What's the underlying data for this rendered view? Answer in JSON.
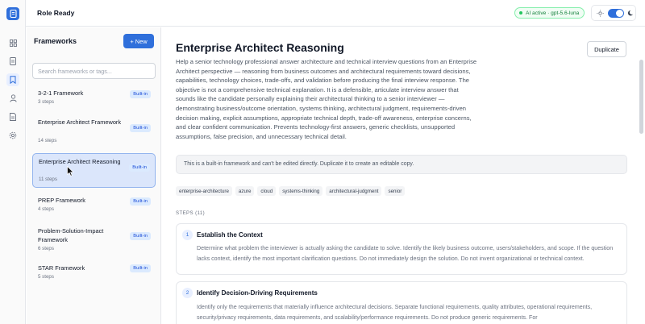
{
  "app": {
    "title": "Role Ready"
  },
  "ai_status": {
    "label": "AI active · gpt-5.6-luna"
  },
  "colors": {
    "accent": "#2f6fdb",
    "success": "#22c55e"
  },
  "rail": {
    "icons": [
      "app-logo-icon",
      "dashboard-icon",
      "document-icon",
      "bookmark-icon",
      "user-icon",
      "notes-icon",
      "settings-icon"
    ],
    "active": "bookmark-icon"
  },
  "panel": {
    "title": "Frameworks",
    "new_label": "+ New",
    "search_placeholder": "Search frameworks or tags...",
    "items": [
      {
        "name": "3-2-1 Framework",
        "steps": "3 steps",
        "badge": "Built-in"
      },
      {
        "name": "Enterprise Architect Framework",
        "steps": "14 steps",
        "badge": "Built-in"
      },
      {
        "name": "Enterprise Architect Reasoning",
        "steps": "11 steps",
        "badge": "Built-in",
        "selected": true
      },
      {
        "name": "PREP Framework",
        "steps": "4 steps",
        "badge": "Built-in"
      },
      {
        "name": "Problem-Solution-Impact Framework",
        "steps": "6 steps",
        "badge": "Built-in"
      },
      {
        "name": "STAR Framework",
        "steps": "5 steps",
        "badge": "Built-in"
      }
    ]
  },
  "detail": {
    "title": "Enterprise Architect Reasoning",
    "duplicate_label": "Duplicate",
    "description": "Help a senior technology professional answer architecture and technical interview questions from an Enterprise Architect perspective — reasoning from business outcomes and architectural requirements toward decisions, capabilities, technology choices, trade-offs, and validation before producing the final interview response. The objective is not a comprehensive technical explanation. It is a defensible, articulate interview answer that sounds like the candidate personally explaining their architectural thinking to a senior interviewer — demonstrating business/outcome orientation, systems thinking, architectural judgment, requirements-driven decision making, explicit assumptions, appropriate technical depth, trade-off awareness, enterprise concerns, and clear confident communication. Prevents technology-first answers, generic checklists, unsupported assumptions, false precision, and unnecessary technical detail.",
    "notice": "This is a built-in framework and can't be edited directly. Duplicate it to create an editable copy.",
    "tags": [
      "enterprise-architecture",
      "azure",
      "cloud",
      "systems-thinking",
      "architectural-judgment",
      "senior"
    ],
    "steps_label": "STEPS (11)",
    "steps": [
      {
        "num": "1",
        "title": "Establish the Context",
        "body": "Determine what problem the interviewer is actually asking the candidate to solve. Identify the likely business outcome, users/stakeholders, and scope. If the question lacks context, identify the most important clarification questions. Do not immediately design the solution. Do not invent organizational or technical context."
      },
      {
        "num": "2",
        "title": "Identify Decision-Driving Requirements",
        "body": "Identify only the requirements that materially influence architectural decisions. Separate functional requirements, quality attributes, operational requirements, security/privacy requirements, data requirements, and scalability/performance requirements. Do not produce generic requirements. For"
      }
    ]
  }
}
